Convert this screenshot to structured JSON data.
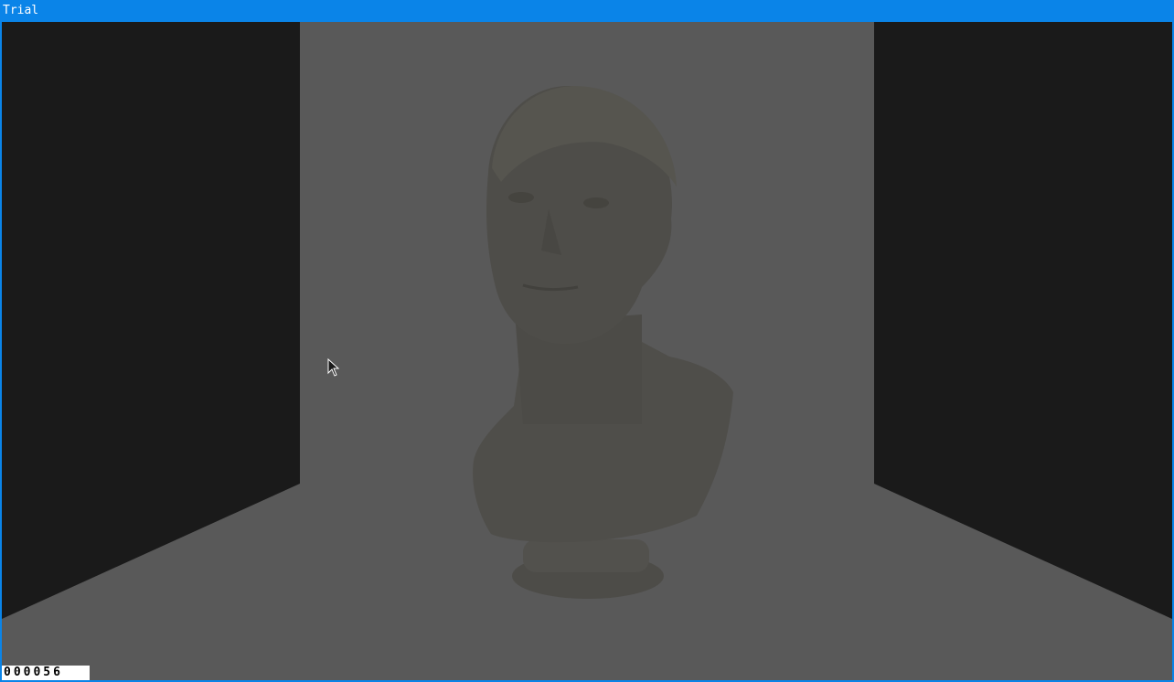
{
  "window": {
    "title": "Trial"
  },
  "scene": {
    "background_color": "#595959",
    "wall_color": "#1a1a1a",
    "bust_color": "#4e4d49"
  },
  "hud": {
    "frame_counter": "000056"
  },
  "cursor": {
    "icon": "mouse-pointer-icon"
  }
}
